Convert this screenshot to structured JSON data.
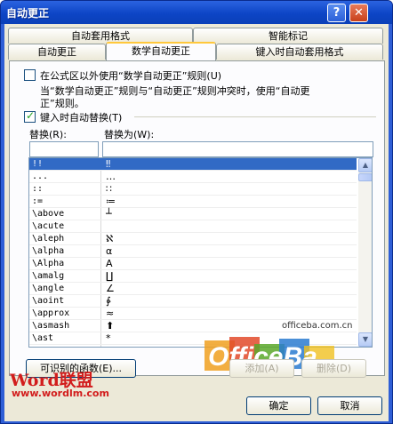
{
  "window": {
    "title": "自动更正",
    "help_symbol": "?",
    "close_symbol": "✕"
  },
  "tabs": {
    "row1": [
      "自动套用格式",
      "智能标记"
    ],
    "row2": [
      "自动更正",
      "数学自动更正",
      "键入时自动套用格式"
    ],
    "active": "数学自动更正"
  },
  "options": {
    "use_outside_math": {
      "label": "在公式区以外使用“数学自动更正”规则(U)",
      "checked": false
    },
    "note_line1": "当“数学自动更正”规则与“自动更正”规则冲突时，使用“自动更",
    "note_line2": "正”规则。",
    "replace_as_type": {
      "label": "键入时自动替换(T)",
      "checked": true
    }
  },
  "fields": {
    "replace_label": "替换(R):",
    "with_label": "替换为(W):",
    "replace_value": "",
    "with_value": ""
  },
  "table": {
    "rows": [
      {
        "key": "!!",
        "value": "‼",
        "selected": true
      },
      {
        "key": "...",
        "value": "…",
        "selected": false
      },
      {
        "key": "::",
        "value": "∷",
        "selected": false
      },
      {
        "key": ":=",
        "value": "≔",
        "selected": false
      },
      {
        "key": "\\above",
        "value": "┴",
        "selected": false
      },
      {
        "key": "\\acute",
        "value": "",
        "selected": false
      },
      {
        "key": "\\aleph",
        "value": "ℵ",
        "selected": false
      },
      {
        "key": "\\alpha",
        "value": "α",
        "selected": false
      },
      {
        "key": "\\Alpha",
        "value": "A",
        "selected": false
      },
      {
        "key": "\\amalg",
        "value": "∐",
        "selected": false
      },
      {
        "key": "\\angle",
        "value": "∠",
        "selected": false
      },
      {
        "key": "\\aoint",
        "value": "∳",
        "selected": false
      },
      {
        "key": "\\approx",
        "value": "≈",
        "selected": false
      },
      {
        "key": "\\asmash",
        "value": "⬆",
        "selected": false
      },
      {
        "key": "\\ast",
        "value": "*",
        "selected": false
      }
    ],
    "scroll_up": "▲",
    "scroll_down": "▼"
  },
  "buttons": {
    "functions": "可识别的函数(E)...",
    "add": "添加(A)",
    "delete": "删除(D)",
    "ok": "确定",
    "cancel": "取消"
  },
  "watermark": {
    "wordlm_title": "Word联盟",
    "wordlm_url": "www.wordlm.com",
    "officeba_url": "officeba.com.cn",
    "officeba_logo": "OfficeBa"
  }
}
